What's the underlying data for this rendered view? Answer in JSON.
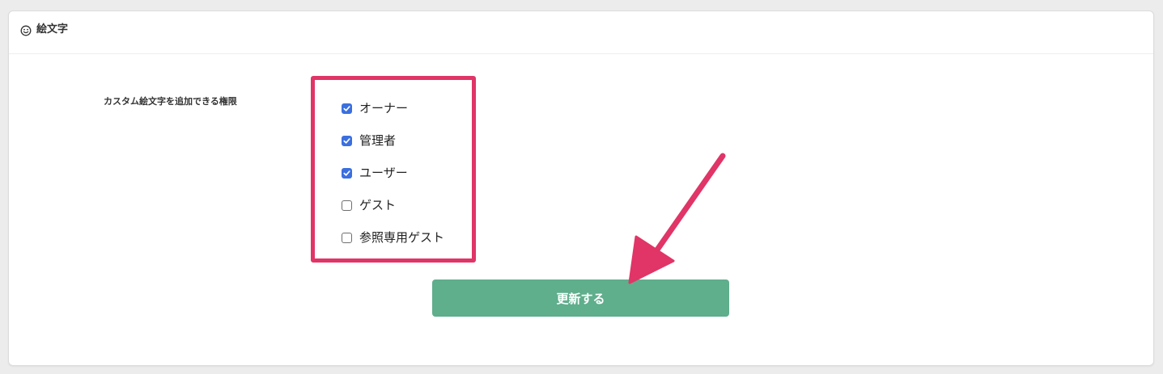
{
  "section": {
    "title": "絵文字",
    "icon": "smiley-face-icon"
  },
  "permissions": {
    "label": "カスタム絵文字を追加できる権限",
    "options": [
      {
        "label": "オーナー",
        "checked": true
      },
      {
        "label": "管理者",
        "checked": true
      },
      {
        "label": "ユーザー",
        "checked": true
      },
      {
        "label": "ゲスト",
        "checked": false
      },
      {
        "label": "参照専用ゲスト",
        "checked": false
      }
    ]
  },
  "actions": {
    "submit_label": "更新する"
  },
  "annotations": {
    "highlight_color": "#e03566",
    "arrow_color": "#e03566"
  },
  "colors": {
    "checkbox_checked": "#3b6fe0",
    "submit_button": "#5fae8c"
  }
}
